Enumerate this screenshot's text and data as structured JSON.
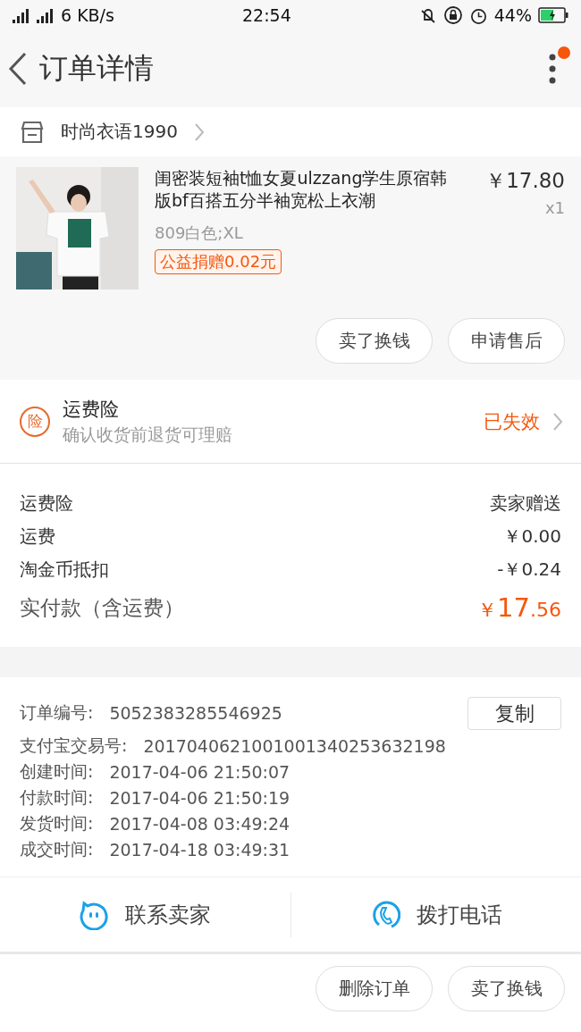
{
  "status_bar": {
    "network": "6 KB/s",
    "time": "22:54",
    "battery": "44%"
  },
  "header": {
    "title": "订单详情",
    "notification_dot": true
  },
  "shop": {
    "name": "时尚衣语1990"
  },
  "product": {
    "image": {
      "kind": "picture"
    },
    "title": "闺密装短袖t恤女夏ulzzang学生原宿韩版bf百搭五分半袖宽松上衣潮",
    "price": "￥17.80",
    "quantity": "x1",
    "sku": "809白色;XL",
    "charity_tag": "公益捐赠0.02元",
    "actions": [
      "卖了换钱",
      "申请售后"
    ]
  },
  "insurance": {
    "badge": "险",
    "title": "运费险",
    "subtitle": "确认收货前退货可理赔",
    "status": "已失效"
  },
  "fees": [
    {
      "label": "运费险",
      "value": "卖家赠送"
    },
    {
      "label": "运费",
      "value": "￥0.00"
    },
    {
      "label": "淘金币抵扣",
      "value": "-￥0.24"
    }
  ],
  "total": {
    "label": "实付款（含运费）",
    "currency": "￥",
    "integer": "17",
    "decimal": ".56"
  },
  "order_info": {
    "copy_button": "复制",
    "rows": [
      {
        "label": "订单编号:",
        "value": "5052383285546925"
      },
      {
        "label": "支付宝交易号:",
        "value": "2017040621001001340253632198"
      },
      {
        "label": "创建时间:",
        "value": "2017-04-06 21:50:07"
      },
      {
        "label": "付款时间:",
        "value": "2017-04-06 21:50:19"
      },
      {
        "label": "发货时间:",
        "value": "2017-04-08 03:49:24"
      },
      {
        "label": "成交时间:",
        "value": "2017-04-18 03:49:31"
      }
    ]
  },
  "contact": [
    {
      "kind": "chat",
      "label": "联系卖家"
    },
    {
      "kind": "phone",
      "label": "拨打电话"
    }
  ],
  "bottom_actions": [
    "删除订单",
    "卖了换钱"
  ]
}
